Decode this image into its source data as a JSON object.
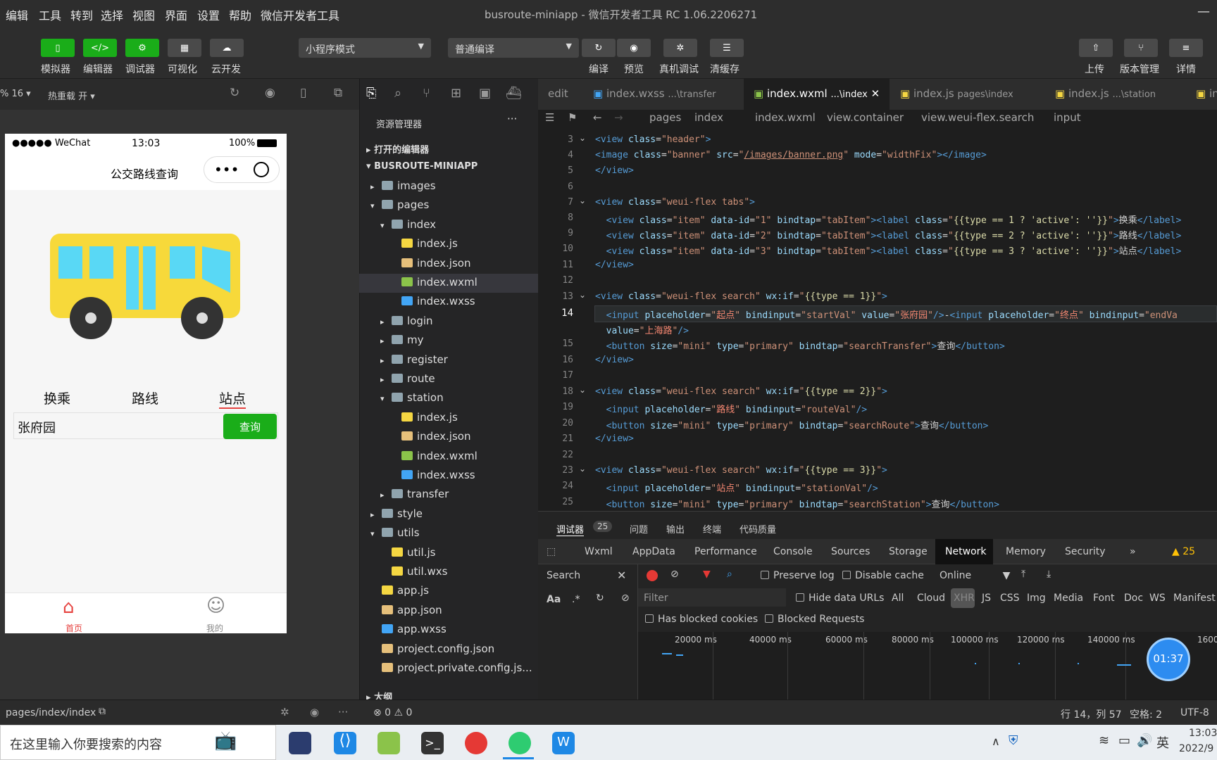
{
  "menu": [
    "编辑",
    "工具",
    "转到",
    "选择",
    "视图",
    "界面",
    "设置",
    "帮助",
    "微信开发者工具"
  ],
  "window_title": "busroute-miniapp - 微信开发者工具 RC 1.06.2206271",
  "toolbar": {
    "left": [
      "模拟器",
      "编辑器",
      "调试器",
      "可视化",
      "云开发"
    ],
    "mode": "小程序模式",
    "compile": "普通编译",
    "mid": [
      "编译",
      "预览",
      "真机调试",
      "清缓存"
    ],
    "right": [
      "上传",
      "版本管理",
      "详情"
    ]
  },
  "simbar": {
    "zoom": "% 16 ▾",
    "hot": "热重载 开 ▾"
  },
  "phone": {
    "carrier": "●●●●● WeChat",
    "time": "13:03",
    "battery": "100%",
    "title": "公交路线查询",
    "tabs": [
      "换乘",
      "路线",
      "站点"
    ],
    "input_value": "张府园",
    "search_btn": "查询",
    "nav": [
      "首页",
      "我的"
    ]
  },
  "explorer": {
    "title": "资源管理器",
    "open_editors": "打开的编辑器",
    "root": "BUSROUTE-MINIAPP",
    "items": [
      "images",
      "pages",
      "index",
      "index.js",
      "index.json",
      "index.wxml",
      "index.wxss",
      "login",
      "my",
      "register",
      "route",
      "station",
      "index.js",
      "index.json",
      "index.wxml",
      "index.wxss",
      "transfer",
      "style",
      "utils",
      "util.js",
      "util.wxs",
      "app.js",
      "app.json",
      "app.wxss",
      "project.config.json",
      "project.private.config.js..."
    ],
    "outline": "大纲"
  },
  "tabs": [
    "edit",
    "index.wxss",
    "...\\transfer",
    "index.wxml",
    "...\\index",
    "index.js",
    "pages\\index",
    "index.js",
    "...\\station",
    "in"
  ],
  "crumb": [
    "pages",
    "index",
    "index.wxml",
    "view.container",
    "view.weui-flex.search",
    "input"
  ],
  "lines": [
    "3",
    "4",
    "5",
    "6",
    "7",
    "8",
    "9",
    "10",
    "11",
    "12",
    "13",
    "14",
    "",
    "15",
    "16",
    "17",
    "18",
    "19",
    "20",
    "21",
    "22",
    "23",
    "24",
    "25"
  ],
  "devtools": {
    "top": [
      "调试器",
      "25",
      "问题",
      "输出",
      "终端",
      "代码质量"
    ],
    "panels": [
      "Wxml",
      "AppData",
      "Performance",
      "Console",
      "Sources",
      "Storage",
      "Network",
      "Memory",
      "Security",
      "»"
    ],
    "warn": "▲ 25",
    "search": "Search",
    "preserve": "Preserve log",
    "disable": "Disable cache",
    "online": "Online",
    "filter": "Filter",
    "hide": "Hide data URLs",
    "types": [
      "All",
      "Cloud",
      "XHR",
      "JS",
      "CSS",
      "Img",
      "Media",
      "Font",
      "Doc",
      "WS",
      "Manifest"
    ],
    "blocked_cookies": "Has blocked cookies",
    "blocked_req": "Blocked Requests",
    "aa": "Aa",
    "timeline": [
      "20000 ms",
      "40000 ms",
      "60000 ms",
      "80000 ms",
      "100000 ms",
      "120000 ms",
      "140000 ms",
      "1600"
    ],
    "timer": "01:37"
  },
  "status": {
    "path": "pages/index/index",
    "errors": "⊗ 0 ⚠ 0",
    "pos": "行 14，列 57",
    "spaces": "空格: 2",
    "enc": "UTF-8"
  },
  "taskbar": {
    "search": "在这里输入你要搜索的内容",
    "ime": "英",
    "time": "13:03",
    "date": "2022/9"
  },
  "colors": {
    "green": "#1aad19",
    "bus": "#f7d93a",
    "window": "#59d8f5"
  }
}
